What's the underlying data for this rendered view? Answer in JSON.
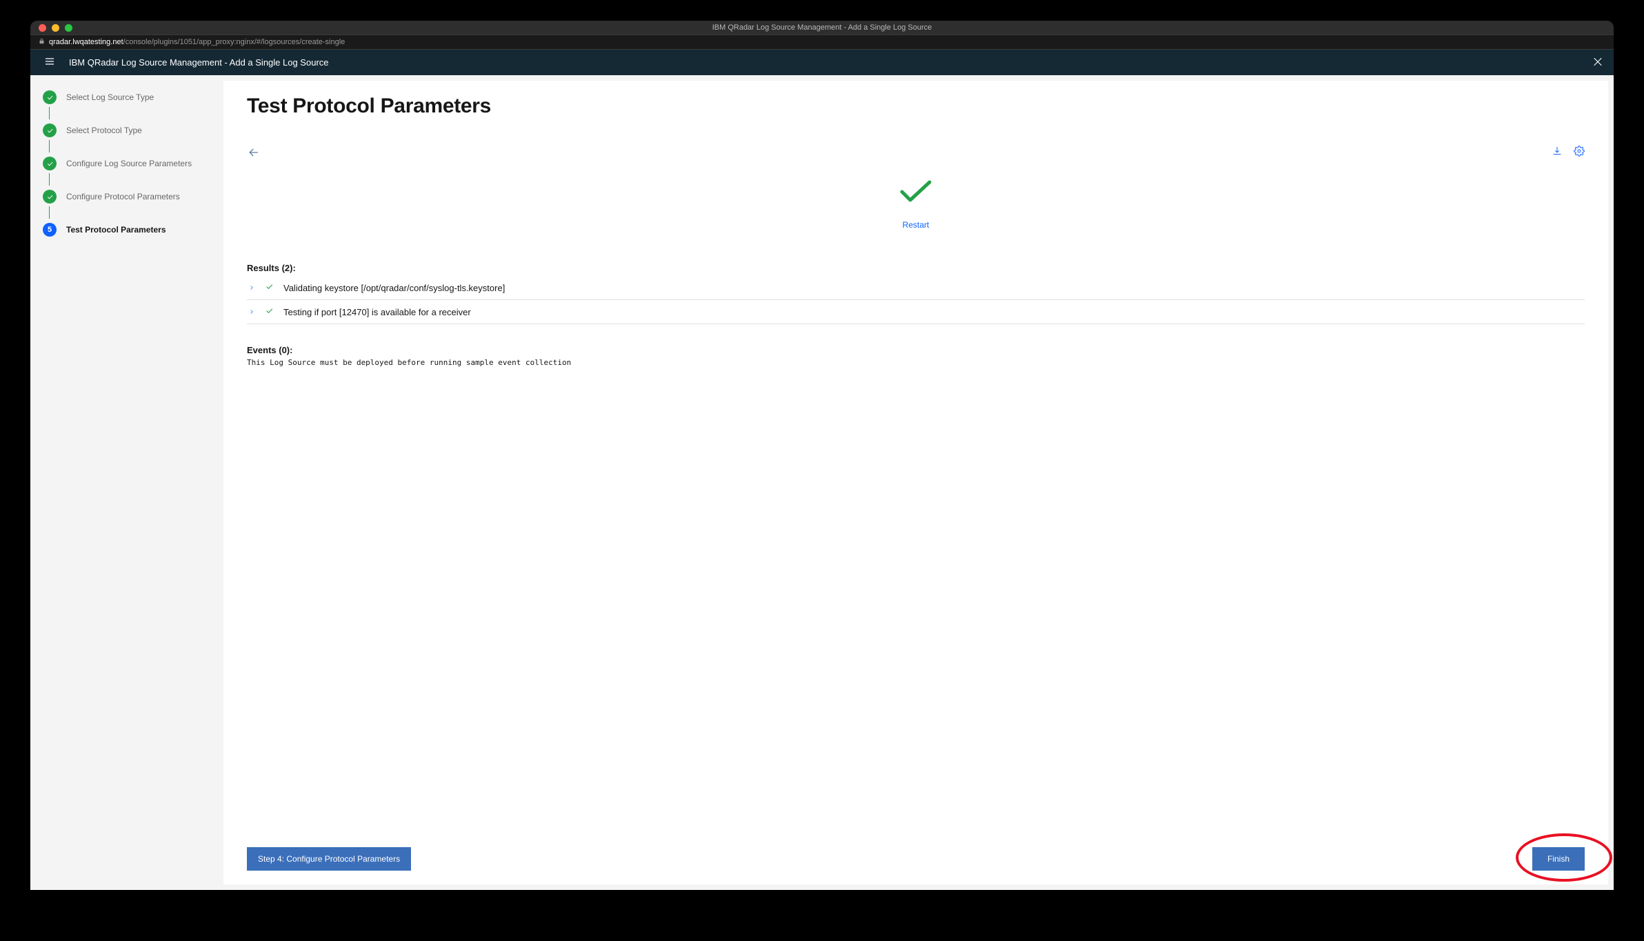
{
  "window": {
    "title": "IBM QRadar Log Source Management - Add a Single Log Source"
  },
  "url": {
    "host": "qradar.lwqatesting.net",
    "path": "/console/plugins/1051/app_proxy:nginx/#/logsources/create-single"
  },
  "header": {
    "title": "IBM QRadar Log Source Management - Add a Single Log Source"
  },
  "sidebar": {
    "steps": [
      {
        "label": "Select Log Source Type",
        "state": "done"
      },
      {
        "label": "Select Protocol Type",
        "state": "done"
      },
      {
        "label": "Configure Log Source Parameters",
        "state": "done"
      },
      {
        "label": "Configure Protocol Parameters",
        "state": "done"
      },
      {
        "label": "Test Protocol Parameters",
        "state": "current",
        "number": "5"
      }
    ]
  },
  "main": {
    "title": "Test Protocol Parameters",
    "restart_label": "Restart",
    "results_heading": "Results (2):",
    "results": [
      {
        "text": "Validating keystore [/opt/qradar/conf/syslog-tls.keystore]"
      },
      {
        "text": "Testing if port [12470] is available for a receiver"
      }
    ],
    "events_heading": "Events (0):",
    "events_note": "This Log Source must be deployed before running sample event collection"
  },
  "footer": {
    "back_label": "Step 4: Configure Protocol Parameters",
    "finish_label": "Finish"
  }
}
